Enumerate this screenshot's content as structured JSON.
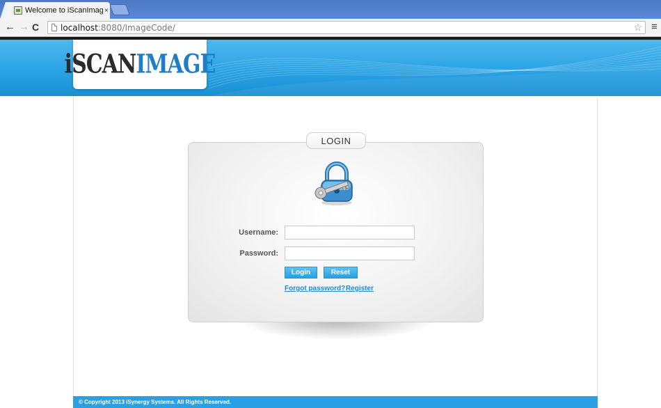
{
  "browser": {
    "tab_title": "Welcome to iScanImag",
    "tab_close": "×",
    "url_host": "localhost",
    "url_rest": ":8080/ImageCode/",
    "back_icon": "←",
    "forward_icon": "→",
    "reload_icon": "C",
    "star_icon": "☆",
    "menu_icon": "≡"
  },
  "header": {
    "logo_part1": "iSCAN",
    "logo_part2": "IMAGE"
  },
  "login": {
    "heading": "LOGIN",
    "icon": "padlock-key-icon",
    "username_label": "Username:",
    "username_value": "",
    "password_label": "Password:",
    "password_value": "",
    "login_button": "Login",
    "reset_button": "Reset",
    "forgot_link": "Forgot password?",
    "register_link": "Register"
  },
  "footer": {
    "copyright": "© Copyright 2013 iSynergy Systems. All Rights Reserved."
  },
  "colors": {
    "brand_blue": "#2aa3e3",
    "button_blue": "#2a9fe0",
    "link_blue": "#1e88d0"
  }
}
